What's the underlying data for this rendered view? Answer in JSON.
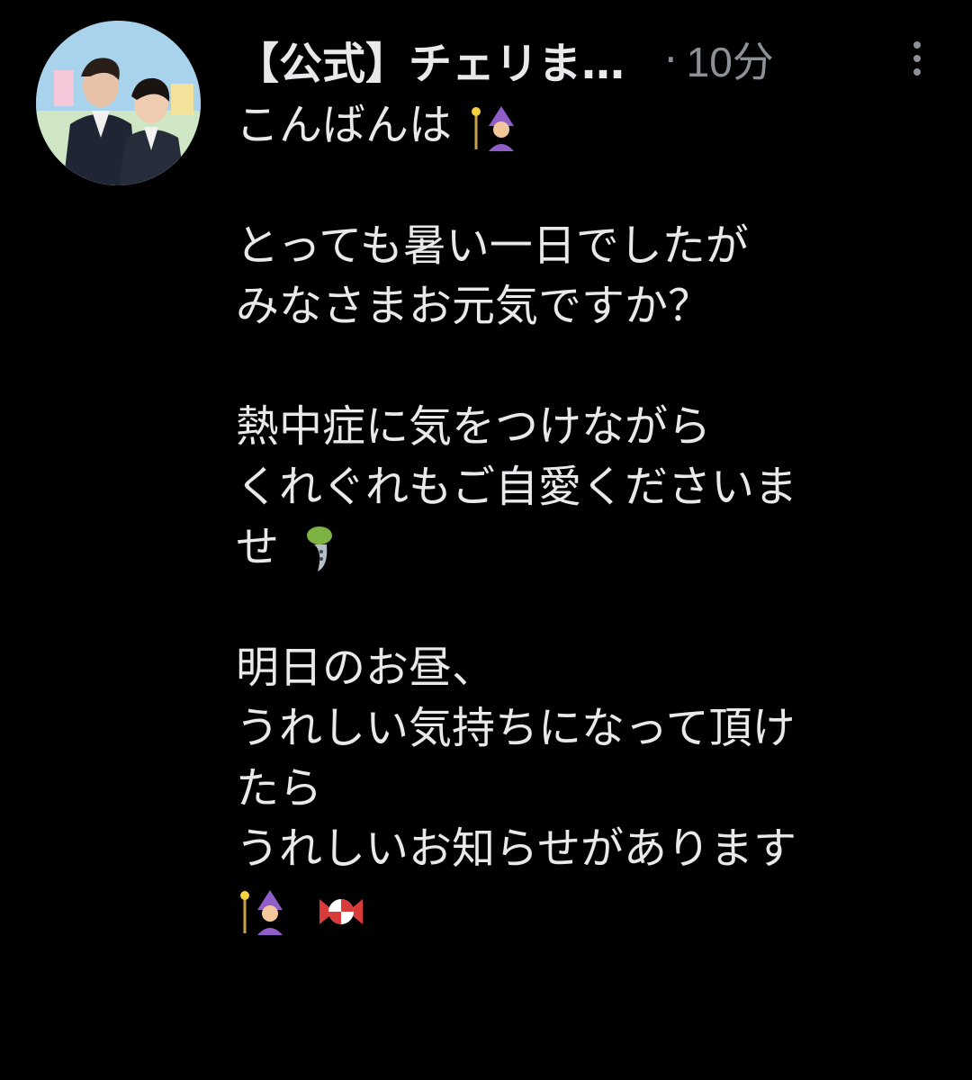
{
  "post": {
    "author": "【公式】チェリま…",
    "separator": "·",
    "time": "10分",
    "lines": {
      "l1": "こんばんは",
      "l2": "とっても暑い一日でしたが",
      "l3": "みなさまお元気ですか？",
      "l4": "熱中症に気をつけながら",
      "l5": "くれぐれもご自愛くださいま",
      "l6": "せ",
      "l7": "明日のお昼、",
      "l8": "うれしい気持ちになって頂け",
      "l9": "たら",
      "l10": "うれしいお知らせがあります"
    },
    "emojis": [
      "woman-mage-emoji",
      "wind-chime-emoji",
      "woman-mage-emoji",
      "candy-emoji"
    ]
  }
}
